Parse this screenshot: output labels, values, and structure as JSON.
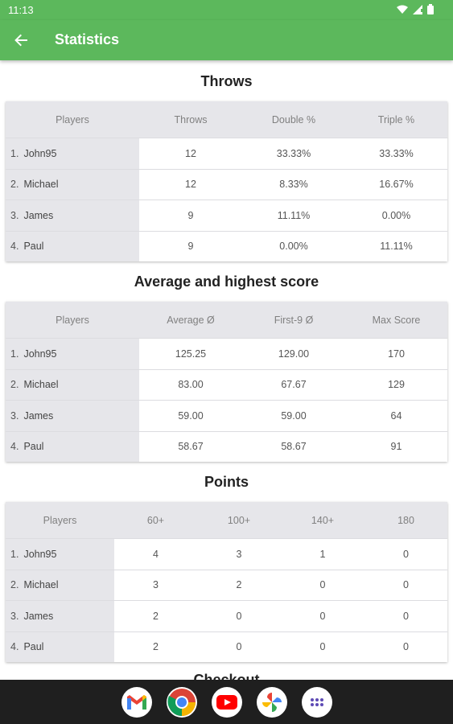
{
  "status_bar": {
    "time": "11:13"
  },
  "app_bar": {
    "title": "Statistics"
  },
  "sections": [
    {
      "title": "Throws",
      "headers": [
        "Players",
        "Throws",
        "Double %",
        "Triple %"
      ],
      "rows": [
        {
          "idx": "1.",
          "name": "John95",
          "values": [
            "12",
            "33.33%",
            "33.33%"
          ]
        },
        {
          "idx": "2.",
          "name": "Michael",
          "values": [
            "12",
            "8.33%",
            "16.67%"
          ]
        },
        {
          "idx": "3.",
          "name": "James",
          "values": [
            "9",
            "11.11%",
            "0.00%"
          ]
        },
        {
          "idx": "4.",
          "name": "Paul",
          "values": [
            "9",
            "0.00%",
            "11.11%"
          ]
        }
      ]
    },
    {
      "title": "Average and highest score",
      "headers": [
        "Players",
        "Average Ø",
        "First-9 Ø",
        "Max Score"
      ],
      "rows": [
        {
          "idx": "1.",
          "name": "John95",
          "values": [
            "125.25",
            "129.00",
            "170"
          ]
        },
        {
          "idx": "2.",
          "name": "Michael",
          "values": [
            "83.00",
            "67.67",
            "129"
          ]
        },
        {
          "idx": "3.",
          "name": "James",
          "values": [
            "59.00",
            "59.00",
            "64"
          ]
        },
        {
          "idx": "4.",
          "name": "Paul",
          "values": [
            "58.67",
            "58.67",
            "91"
          ]
        }
      ]
    },
    {
      "title": "Points",
      "headers": [
        "Players",
        "60+",
        "100+",
        "140+",
        "180"
      ],
      "rows": [
        {
          "idx": "1.",
          "name": "John95",
          "values": [
            "4",
            "3",
            "1",
            "0"
          ]
        },
        {
          "idx": "2.",
          "name": "Michael",
          "values": [
            "3",
            "2",
            "0",
            "0"
          ]
        },
        {
          "idx": "3.",
          "name": "James",
          "values": [
            "2",
            "0",
            "0",
            "0"
          ]
        },
        {
          "idx": "4.",
          "name": "Paul",
          "values": [
            "2",
            "0",
            "0",
            "0"
          ]
        }
      ]
    },
    {
      "title": "Checkout"
    }
  ],
  "dock": {
    "apps": [
      "gmail-icon",
      "chrome-icon",
      "youtube-icon",
      "photos-icon",
      "app-drawer-icon"
    ]
  },
  "colors": {
    "accent": "#5cb85c",
    "nav_background": "#1f1f1f",
    "table_header": "#e6e6ea"
  }
}
